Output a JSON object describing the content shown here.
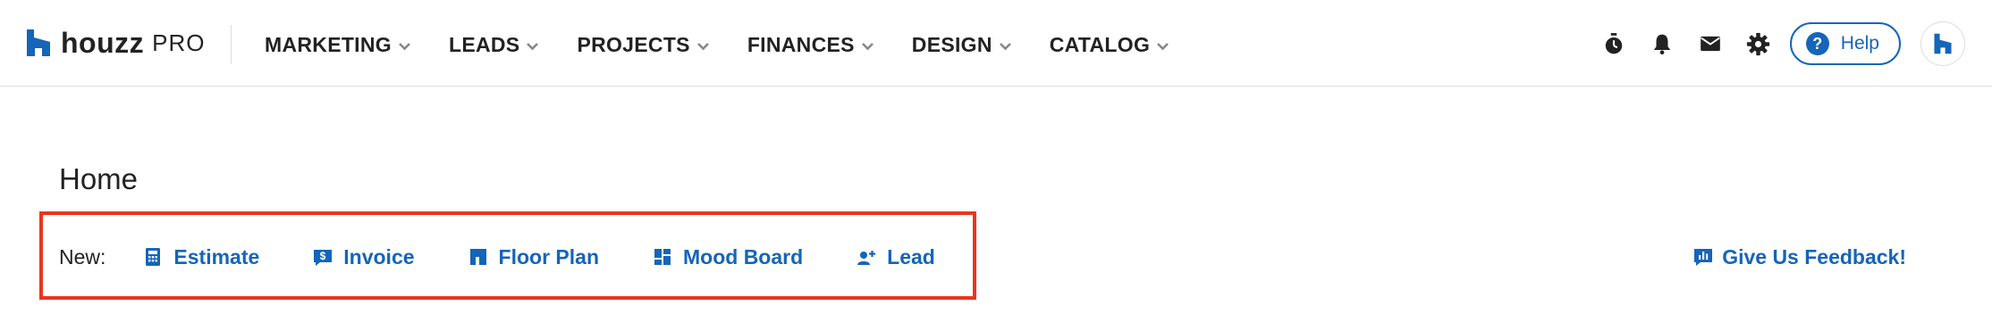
{
  "brand": {
    "wordmark": "houzz",
    "product": "PRO",
    "accent": "#1565b8"
  },
  "nav": {
    "items": [
      {
        "label": "MARKETING",
        "icon": "chevron-down-icon"
      },
      {
        "label": "LEADS",
        "icon": "chevron-down-icon"
      },
      {
        "label": "PROJECTS",
        "icon": "chevron-down-icon"
      },
      {
        "label": "FINANCES",
        "icon": "chevron-down-icon"
      },
      {
        "label": "DESIGN",
        "icon": "chevron-down-icon"
      },
      {
        "label": "CATALOG",
        "icon": "chevron-down-icon"
      }
    ]
  },
  "header_actions": {
    "icons": [
      "timer-icon",
      "bell-icon",
      "mail-icon",
      "gear-icon"
    ],
    "help_label": "Help",
    "avatar_icon": "houzz-logo-icon"
  },
  "page": {
    "title": "Home"
  },
  "quick_create": {
    "label": "New:",
    "items": [
      {
        "label": "Estimate",
        "icon": "calculator-icon"
      },
      {
        "label": "Invoice",
        "icon": "invoice-dollar-icon"
      },
      {
        "label": "Floor Plan",
        "icon": "floor-plan-icon"
      },
      {
        "label": "Mood Board",
        "icon": "mood-board-icon"
      },
      {
        "label": "Lead",
        "icon": "add-person-icon"
      }
    ],
    "highlight_color": "#e8361c"
  },
  "feedback": {
    "label": "Give Us Feedback!",
    "icon": "chart-feedback-icon"
  }
}
